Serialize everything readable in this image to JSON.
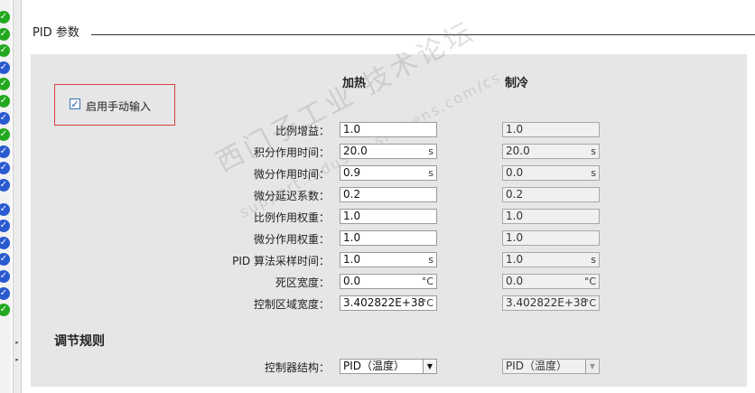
{
  "section": {
    "title": "PID 参数"
  },
  "manual_input": {
    "label": "启用手动输入",
    "checked": true
  },
  "columns": {
    "heating": "加热",
    "cooling": "制冷"
  },
  "rows": [
    {
      "label": "比例增益：",
      "heat": "1.0",
      "heat_unit": "",
      "cool": "1.0",
      "cool_unit": ""
    },
    {
      "label": "积分作用时间：",
      "heat": "20.0",
      "heat_unit": "s",
      "cool": "20.0",
      "cool_unit": "s"
    },
    {
      "label": "微分作用时间：",
      "heat": "0.9",
      "heat_unit": "s",
      "cool": "0.0",
      "cool_unit": "s"
    },
    {
      "label": "微分延迟系数：",
      "heat": "0.2",
      "heat_unit": "",
      "cool": "0.2",
      "cool_unit": ""
    },
    {
      "label": "比例作用权重：",
      "heat": "1.0",
      "heat_unit": "",
      "cool": "1.0",
      "cool_unit": ""
    },
    {
      "label": "微分作用权重：",
      "heat": "1.0",
      "heat_unit": "",
      "cool": "1.0",
      "cool_unit": ""
    },
    {
      "label": "PID 算法采样时间：",
      "heat": "1.0",
      "heat_unit": "s",
      "cool": "1.0",
      "cool_unit": "s"
    },
    {
      "label": "死区宽度：",
      "heat": "0.0",
      "heat_unit": "°C",
      "cool": "0.0",
      "cool_unit": "°C"
    },
    {
      "label": "控制区域宽度：",
      "heat": "3.402822E+38",
      "heat_unit": "°C",
      "cool": "3.402822E+38",
      "cool_unit": "°C"
    }
  ],
  "tuning": {
    "heading": "调节规则",
    "structure_label": "控制器结构：",
    "heat_value": "PID（温度）",
    "cool_value": "PID（温度）"
  },
  "watermark": {
    "line1": "西门子工业 技术论坛",
    "line2": "support.industry.siemens.com/cs"
  },
  "status_icons": [
    "ok",
    "ok",
    "ok",
    "info",
    "ok",
    "ok",
    "info",
    "ok",
    "info",
    "info",
    "info",
    "info",
    "info",
    "info",
    "info",
    "info",
    "info",
    "ok"
  ],
  "colors": {
    "ok": "#22a81e",
    "info": "#2a5ad0",
    "highlight": "#d64040"
  }
}
